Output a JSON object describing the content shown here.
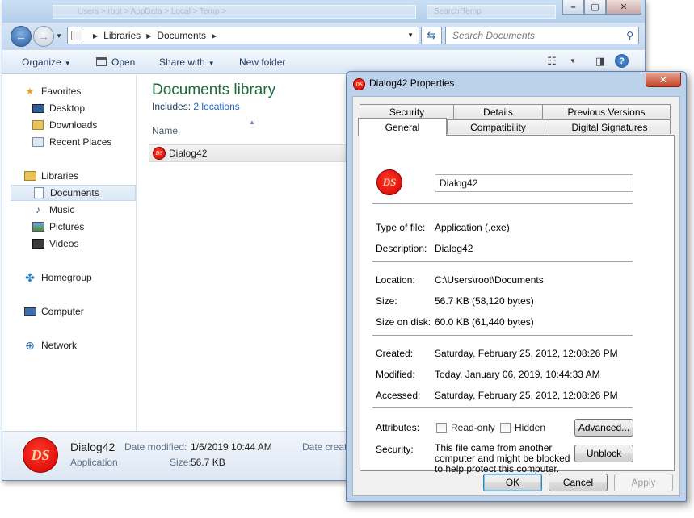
{
  "explorer": {
    "ghost_address": "Users > root > AppData > Local > Temp >",
    "ghost_search": "Search Temp",
    "address": {
      "segments": [
        "Libraries",
        "Documents"
      ]
    },
    "search_placeholder": "Search Documents",
    "toolbar": {
      "organize": "Organize",
      "open": "Open",
      "share_with": "Share with",
      "new_folder": "New folder"
    },
    "nav": {
      "favorites": "Favorites",
      "desktop": "Desktop",
      "downloads": "Downloads",
      "recent_places": "Recent Places",
      "libraries": "Libraries",
      "documents": "Documents",
      "music": "Music",
      "pictures": "Pictures",
      "videos": "Videos",
      "homegroup": "Homegroup",
      "computer": "Computer",
      "network": "Network"
    },
    "library": {
      "title": "Documents library",
      "includes_label": "Includes:",
      "locations_link": "2 locations",
      "column_name": "Name"
    },
    "files": [
      {
        "name": "Dialog42"
      }
    ],
    "details": {
      "name": "Dialog42",
      "type": "Application",
      "date_modified_label": "Date modified:",
      "date_modified_value": "1/6/2019 10:44 AM",
      "size_label": "Size:",
      "size_value": "56.7 KB",
      "date_created_label": "Date create"
    }
  },
  "dialog": {
    "title": "Dialog42 Properties",
    "tabs_back": [
      "Security",
      "Details",
      "Previous Versions"
    ],
    "tabs_front": [
      "General",
      "Compatibility",
      "Digital Signatures"
    ],
    "active_tab": "General",
    "file_name": "Dialog42",
    "type_of_file_label": "Type of file:",
    "type_of_file": "Application (.exe)",
    "description_label": "Description:",
    "description": "Dialog42",
    "location_label": "Location:",
    "location": "C:\\Users\\root\\Documents",
    "size_label": "Size:",
    "size": "56.7 KB (58,120 bytes)",
    "size_on_disk_label": "Size on disk:",
    "size_on_disk": "60.0 KB (61,440 bytes)",
    "created_label": "Created:",
    "created": "Saturday, February 25, 2012, 12:08:26 PM",
    "modified_label": "Modified:",
    "modified": "Today, January 06, 2019, 10:44:33 AM",
    "accessed_label": "Accessed:",
    "accessed": "Saturday, February 25, 2012, 12:08:26 PM",
    "attributes_label": "Attributes:",
    "readonly_label": "Read-only",
    "hidden_label": "Hidden",
    "advanced_button": "Advanced...",
    "security_label": "Security:",
    "security_text": "This file came from another computer and might be blocked to help protect this computer.",
    "unblock_button": "Unblock",
    "ok_button": "OK",
    "cancel_button": "Cancel",
    "apply_button": "Apply"
  },
  "colors": {
    "library_title": "#1e6a3a",
    "link": "#1d64c7",
    "logo_red": "#d40000"
  }
}
